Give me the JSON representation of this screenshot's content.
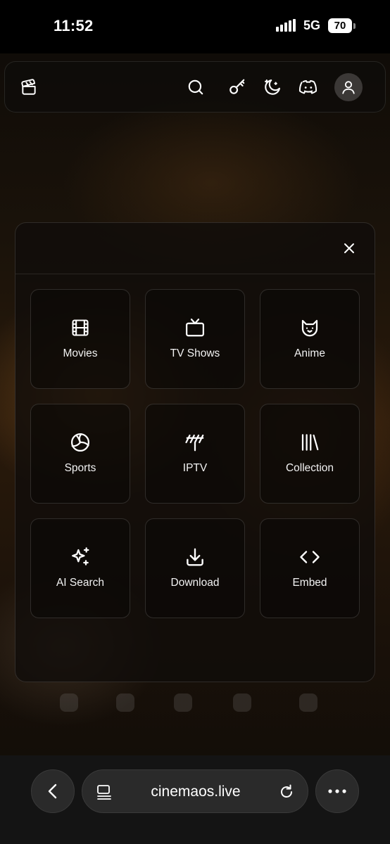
{
  "status_bar": {
    "time": "11:52",
    "network": "5G",
    "battery": "70"
  },
  "header": {
    "icons": [
      "clapperboard-icon",
      "search-icon",
      "key-icon",
      "moon-stars-icon",
      "discord-icon",
      "user-icon"
    ]
  },
  "menu": {
    "close_icon": "close-icon",
    "items": [
      {
        "label": "Movies",
        "icon": "film-icon"
      },
      {
        "label": "TV Shows",
        "icon": "tv-icon"
      },
      {
        "label": "Anime",
        "icon": "cat-icon"
      },
      {
        "label": "Sports",
        "icon": "volleyball-icon"
      },
      {
        "label": "IPTV",
        "icon": "antenna-icon"
      },
      {
        "label": "Collection",
        "icon": "library-icon"
      },
      {
        "label": "AI Search",
        "icon": "sparkles-icon"
      },
      {
        "label": "Download",
        "icon": "download-icon"
      },
      {
        "label": "Embed",
        "icon": "code-icon"
      }
    ]
  },
  "browser": {
    "url": "cinemaos.live"
  },
  "colors": {
    "background": "#0b0906",
    "accent_warm": "#96601f",
    "tile_border": "#2c2a28",
    "text": "#ffffff"
  }
}
